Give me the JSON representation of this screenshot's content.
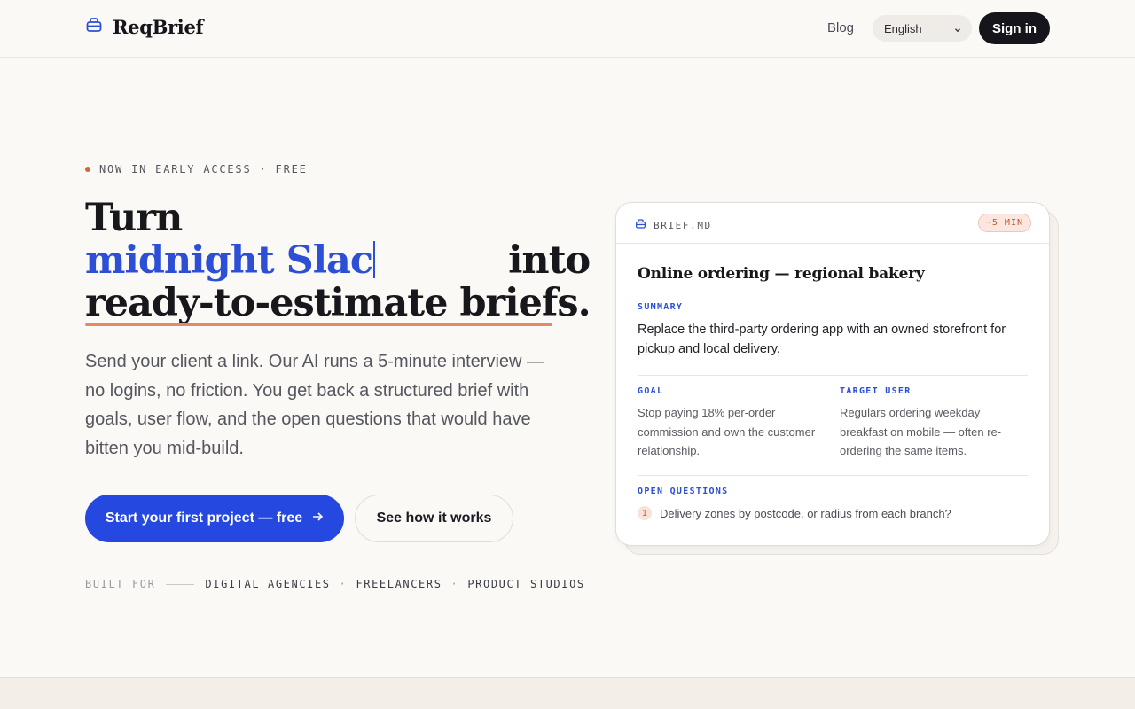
{
  "header": {
    "logo_text": "ReqBrief",
    "nav_blog": "Blog",
    "language": "English",
    "signin_label": "Sign in"
  },
  "hero": {
    "eyebrow": "NOW IN EARLY ACCESS · FREE",
    "headline_line1": "Turn",
    "headline_typed": "midnight Slac",
    "headline_after": "into",
    "headline_line3": "ready-to-estimate briefs.",
    "subtitle": "Send your client a link. Our AI runs a 5-minute interview — no logins, no friction. You get back a structured brief with goals, user flow, and the open questions that would have bitten you mid-build.",
    "cta_primary": "Start your first project — free",
    "cta_secondary": "See how it works",
    "built_for_label": "BUILT FOR",
    "audiences": [
      "DIGITAL AGENCIES",
      "FREELANCERS",
      "PRODUCT STUDIOS"
    ],
    "separator": "·"
  },
  "brief_card": {
    "filename": "BRIEF.MD",
    "time_badge": "~5 MIN",
    "title": "Online ordering — regional bakery",
    "summary_label": "SUMMARY",
    "summary": "Replace the third-party ordering app with an owned storefront for pickup and local delivery.",
    "goal_label": "GOAL",
    "goal": "Stop paying 18% per-order commission and own the customer relationship.",
    "target_user_label": "TARGET USER",
    "target_user": "Regulars ordering weekday breakfast on mobile — often re-ordering the same items.",
    "open_questions_label": "OPEN QUESTIONS",
    "questions": [
      {
        "number": "1",
        "text": "Delivery zones by postcode, or radius from each branch?"
      }
    ]
  },
  "colors": {
    "accent_blue": "#2448e0",
    "accent_orange": "#d5643b",
    "background": "#fbf9f6",
    "dark": "#15151b"
  }
}
